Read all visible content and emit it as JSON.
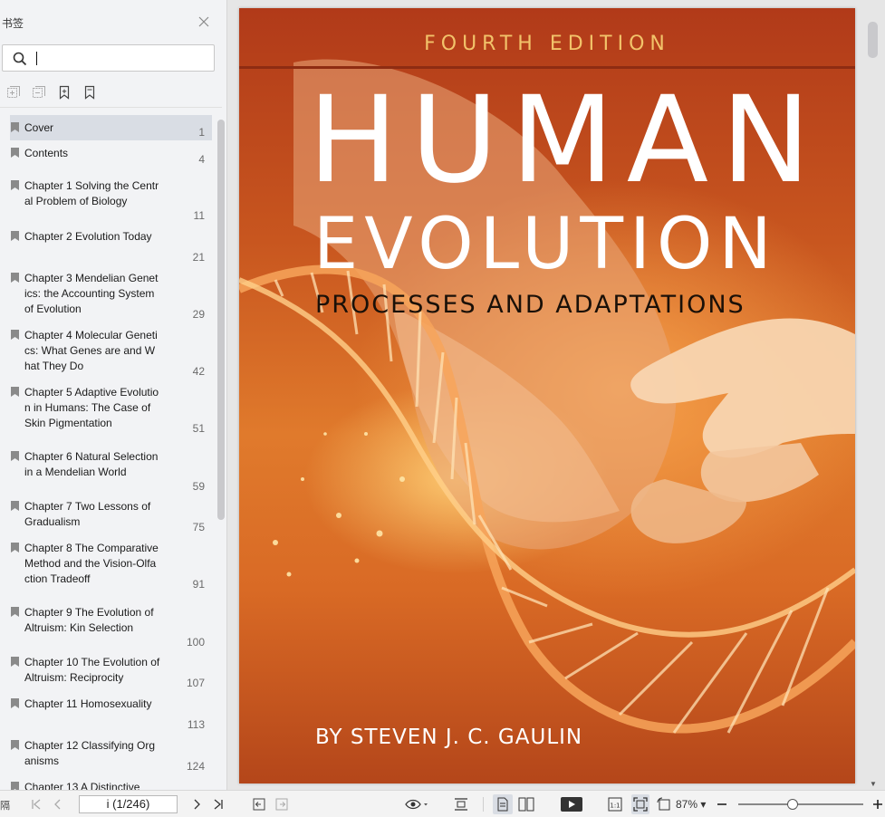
{
  "panel": {
    "title": "书签",
    "search": {
      "value": "",
      "placeholder": ""
    },
    "bookmarks": [
      {
        "label": "Cover",
        "page": "1"
      },
      {
        "label": "Contents",
        "page": "4"
      },
      {
        "label": "Chapter 1 Solving the Central Problem of Biology",
        "page": "11"
      },
      {
        "label": "Chapter 2 Evolution Today",
        "page": "21"
      },
      {
        "label": "Chapter 3 Mendelian Genetics: the Accounting System of Evolution",
        "page": "29"
      },
      {
        "label": "Chapter 4 Molecular Genetics: What Genes are and What They Do",
        "page": "42"
      },
      {
        "label": "Chapter 5 Adaptive Evolution in Humans: The Case of Skin Pigmentation",
        "page": "51"
      },
      {
        "label": "Chapter 6 Natural Selection in a Mendelian World",
        "page": "59"
      },
      {
        "label": "Chapter 7 Two Lessons of Gradualism",
        "page": "75"
      },
      {
        "label": "Chapter 8 The Comparative Method and the Vision-Olfaction Tradeoff",
        "page": "91"
      },
      {
        "label": "Chapter 9 The Evolution of Altruism: Kin Selection",
        "page": "100"
      },
      {
        "label": "Chapter 10 The Evolution of Altruism: Reciprocity",
        "page": "107"
      },
      {
        "label": "Chapter 11 Homosexuality",
        "page": "113"
      },
      {
        "label": "Chapter 12 Classifying Organisms",
        "page": "124"
      },
      {
        "label": "Chapter 13 A Distinctive",
        "page": ""
      }
    ]
  },
  "cover": {
    "edition": "FOURTH EDITION",
    "title_line1": "HUMAN",
    "title_line2": "EVOLUTION",
    "subtitle": "PROCESSES AND ADAPTATIONS",
    "author": "BY STEVEN J. C. GAULIN",
    "colors": {
      "edition": "#f2c36a",
      "title": "#ffffff",
      "subtitle": "#1a1008"
    }
  },
  "statusbar": {
    "page_indicator": "i (1/246)",
    "zoom": "87%",
    "zoom_fraction": 0.43,
    "left_edge_glyph": "隔",
    "actual_size_label": "1:1"
  },
  "icons": [
    "close-icon",
    "search-icon",
    "expand-all-icon",
    "collapse-all-icon",
    "add-bookmark-icon",
    "bookmark-icon",
    "first-page-icon",
    "prev-page-icon",
    "next-page-icon",
    "last-page-icon",
    "back-icon",
    "forward-icon",
    "eye-icon",
    "fit-width-icon",
    "single-page-icon",
    "two-page-icon",
    "play-icon",
    "actual-size-icon",
    "fit-page-icon",
    "rotate-icon",
    "zoom-out-icon",
    "zoom-in-icon"
  ]
}
